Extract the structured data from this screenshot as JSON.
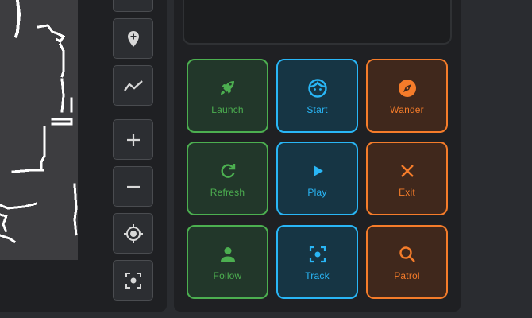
{
  "toolbar": {
    "buttons": [
      {
        "name": "layers-button",
        "icon": "minus-box-icon"
      },
      {
        "name": "add-waypoint-button",
        "icon": "map-marker-plus-icon"
      },
      {
        "name": "path-button",
        "icon": "chart-line-icon"
      },
      {
        "name": "zoom-in-button",
        "icon": "plus-icon"
      },
      {
        "name": "zoom-out-button",
        "icon": "minus-icon"
      },
      {
        "name": "locate-button",
        "icon": "crosshairs-gps-icon"
      },
      {
        "name": "focus-button",
        "icon": "focus-center-icon"
      }
    ]
  },
  "commands": [
    {
      "label": "Launch",
      "icon": "rocket-icon",
      "color": "#4caf50"
    },
    {
      "label": "Start",
      "icon": "face-icon",
      "color": "#29b6f6"
    },
    {
      "label": "Wander",
      "icon": "compass-icon",
      "color": "#f57c2a"
    },
    {
      "label": "Refresh",
      "icon": "refresh-icon",
      "color": "#4caf50"
    },
    {
      "label": "Play",
      "icon": "play-icon",
      "color": "#29b6f6"
    },
    {
      "label": "Exit",
      "icon": "close-icon",
      "color": "#f57c2a"
    },
    {
      "label": "Follow",
      "icon": "account-icon",
      "color": "#4caf50"
    },
    {
      "label": "Track",
      "icon": "focus-center-icon",
      "color": "#29b6f6"
    },
    {
      "label": "Patrol",
      "icon": "magnify-icon",
      "color": "#f57c2a"
    }
  ]
}
